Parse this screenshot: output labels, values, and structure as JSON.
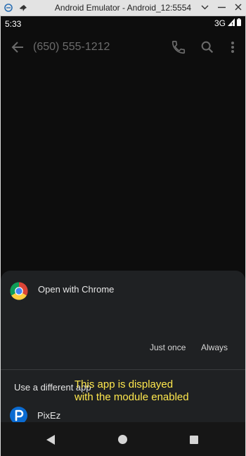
{
  "window": {
    "title": "Android Emulator - Android_12:5554"
  },
  "status_bar": {
    "time": "5:33",
    "network": "3G"
  },
  "app_bar": {
    "title": "(650) 555-1212"
  },
  "chooser": {
    "open_with_label": "Open with Chrome",
    "just_once_label": "Just once",
    "always_label": "Always",
    "different_app_label": "Use a different app",
    "apps": [
      {
        "label": "PixEz",
        "icon": "pixez-icon"
      }
    ]
  },
  "annotation": {
    "text": "This app is displayed\nwith the module enabled",
    "color": "#ffe84d"
  },
  "nav_bar": {
    "buttons": [
      "back",
      "home",
      "recents"
    ]
  }
}
